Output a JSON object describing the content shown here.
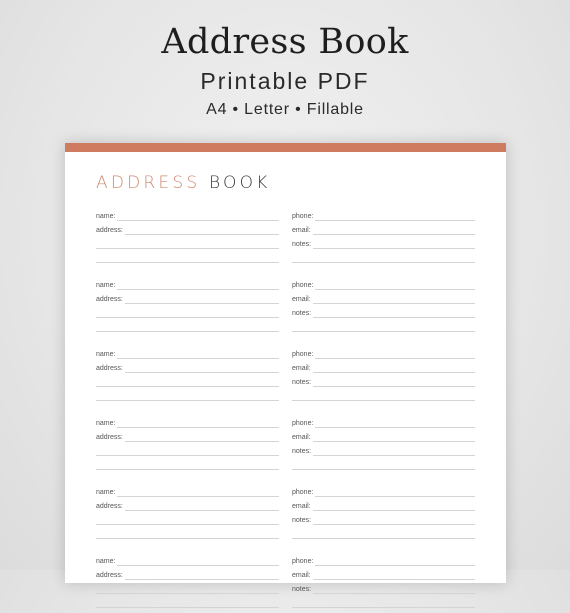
{
  "header": {
    "title": "Address Book",
    "subtitle": "Printable PDF",
    "formats": "A4 • Letter • Fillable"
  },
  "colors": {
    "accent": "#cf7b5f",
    "title_accent": "#cf8a70",
    "text": "#3a3a3a"
  },
  "page": {
    "title_part1": "ADDRESS",
    "title_part2": "BOOK",
    "left_labels": [
      "name:",
      "address:",
      "",
      ""
    ],
    "right_labels": [
      "phone:",
      "email:",
      "notes:",
      ""
    ],
    "entry_count": 6
  }
}
